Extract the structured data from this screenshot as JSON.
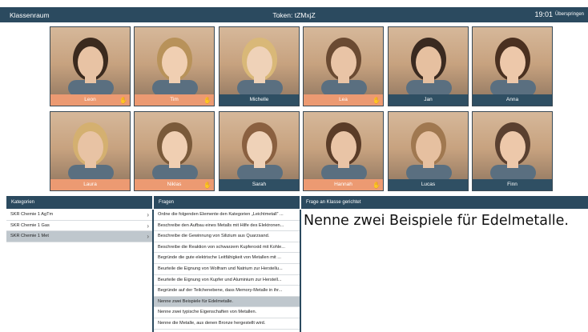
{
  "topbar": {
    "title": "Klassenraum",
    "token": "Token: tZMxjZ",
    "time": "19:01",
    "skip": "Überspringen"
  },
  "students": [
    {
      "name": "Leon",
      "status": "orange",
      "hand": true
    },
    {
      "name": "Tim",
      "status": "orange",
      "hand": true
    },
    {
      "name": "Michelle",
      "status": "blue",
      "hand": false
    },
    {
      "name": "Lea",
      "status": "orange",
      "hand": true
    },
    {
      "name": "Jan",
      "status": "blue",
      "hand": false
    },
    {
      "name": "Anna",
      "status": "blue",
      "hand": false
    },
    {
      "name": "Laura",
      "status": "orange",
      "hand": false
    },
    {
      "name": "Niklas",
      "status": "orange",
      "hand": true
    },
    {
      "name": "Sarah",
      "status": "blue",
      "hand": false
    },
    {
      "name": "Hannah",
      "status": "orange",
      "hand": true
    },
    {
      "name": "Lucas",
      "status": "blue",
      "hand": false
    },
    {
      "name": "Finn",
      "status": "blue",
      "hand": false
    }
  ],
  "panels": {
    "categories_header": "Kategorien",
    "questions_header": "Fragen",
    "frage_header": "Frage an Klasse gerichtet"
  },
  "categories": [
    {
      "label": "SKR Chemie 1 AgTm",
      "selected": false
    },
    {
      "label": "SKR Chemie 1 Gas",
      "selected": false
    },
    {
      "label": "SKR Chemie 1 Met",
      "selected": true
    }
  ],
  "questions": [
    {
      "label": "Ordne die folgenden Elemente den Kategorien „Leichtmetall“ ...",
      "selected": false
    },
    {
      "label": "Beschreibe den Aufbau eines Metalls mit Hilfe des Elektronen...",
      "selected": false
    },
    {
      "label": "Beschreibe die Gewinnung von Silizium aus Quarzsand.",
      "selected": false
    },
    {
      "label": "Beschreibe die Reaktion von schwarzem Kupferoxid mit Kohle...",
      "selected": false
    },
    {
      "label": "Begründe die gute elektrische Leitfähigkeit von Metallen mit ...",
      "selected": false
    },
    {
      "label": "Beurteile die Eignung von Wolfram und Natrium zur Herstellu...",
      "selected": false
    },
    {
      "label": "Beurteile die Eignung von Kupfer und Aluminium zur Herstell...",
      "selected": false
    },
    {
      "label": "Begründe auf der Teilchenebene, dass Memory-Metalle in ihr...",
      "selected": false
    },
    {
      "label": "Nenne zwei Beispiele für Edelmetalle.",
      "selected": true
    },
    {
      "label": "Nenne zwei typische Eigenschaften von Metallen.",
      "selected": false
    },
    {
      "label": "Nenne die Metalle, aus denen Bronze hergestellt wird.",
      "selected": false
    }
  ],
  "current_question": "Nenne zwei Beispiele für Edelmetalle.",
  "colors": {
    "header": "#2b4a5f",
    "orange": "#ec9a72",
    "blue": "#2f4f63",
    "selected_row": "#bfc7cd"
  },
  "icons": {
    "hand": "raised-hand-icon",
    "chevron": "chevron-right-icon"
  }
}
